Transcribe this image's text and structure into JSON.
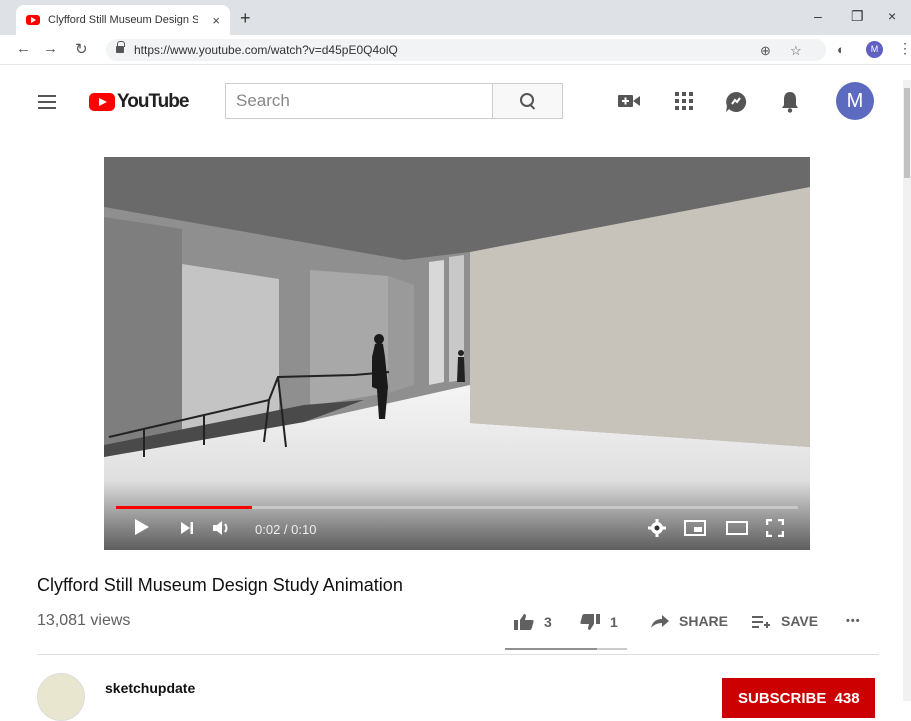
{
  "browser": {
    "tab_title": "Clyfford Still Museum Design Stu",
    "tab_close": "×",
    "new_tab": "+",
    "minimize": "–",
    "restore": "❐",
    "close": "×",
    "url": "https://www.youtube.com/watch?v=d45pE0Q4olQ",
    "profile_initial": "M"
  },
  "youtube": {
    "logo_text": "YouTube",
    "search_placeholder": "Search",
    "avatar_initial": "M"
  },
  "player": {
    "progress_fraction": 0.2,
    "time": "0:02 / 0:10"
  },
  "video": {
    "title": "Clyfford Still Museum Design Study Animation",
    "views": "13,081 views",
    "likes": "3",
    "dislikes": "1",
    "share_label": "SHARE",
    "save_label": "SAVE",
    "more_label": "•••",
    "like_fraction": 0.75
  },
  "channel": {
    "name": "sketchupdate",
    "subscribe_label": "SUBSCRIBE",
    "subscriber_count": "438"
  },
  "colors": {
    "brand": "#ff0000",
    "subscribe_bg": "#cc0000",
    "avatar": "#5c6bc0"
  }
}
